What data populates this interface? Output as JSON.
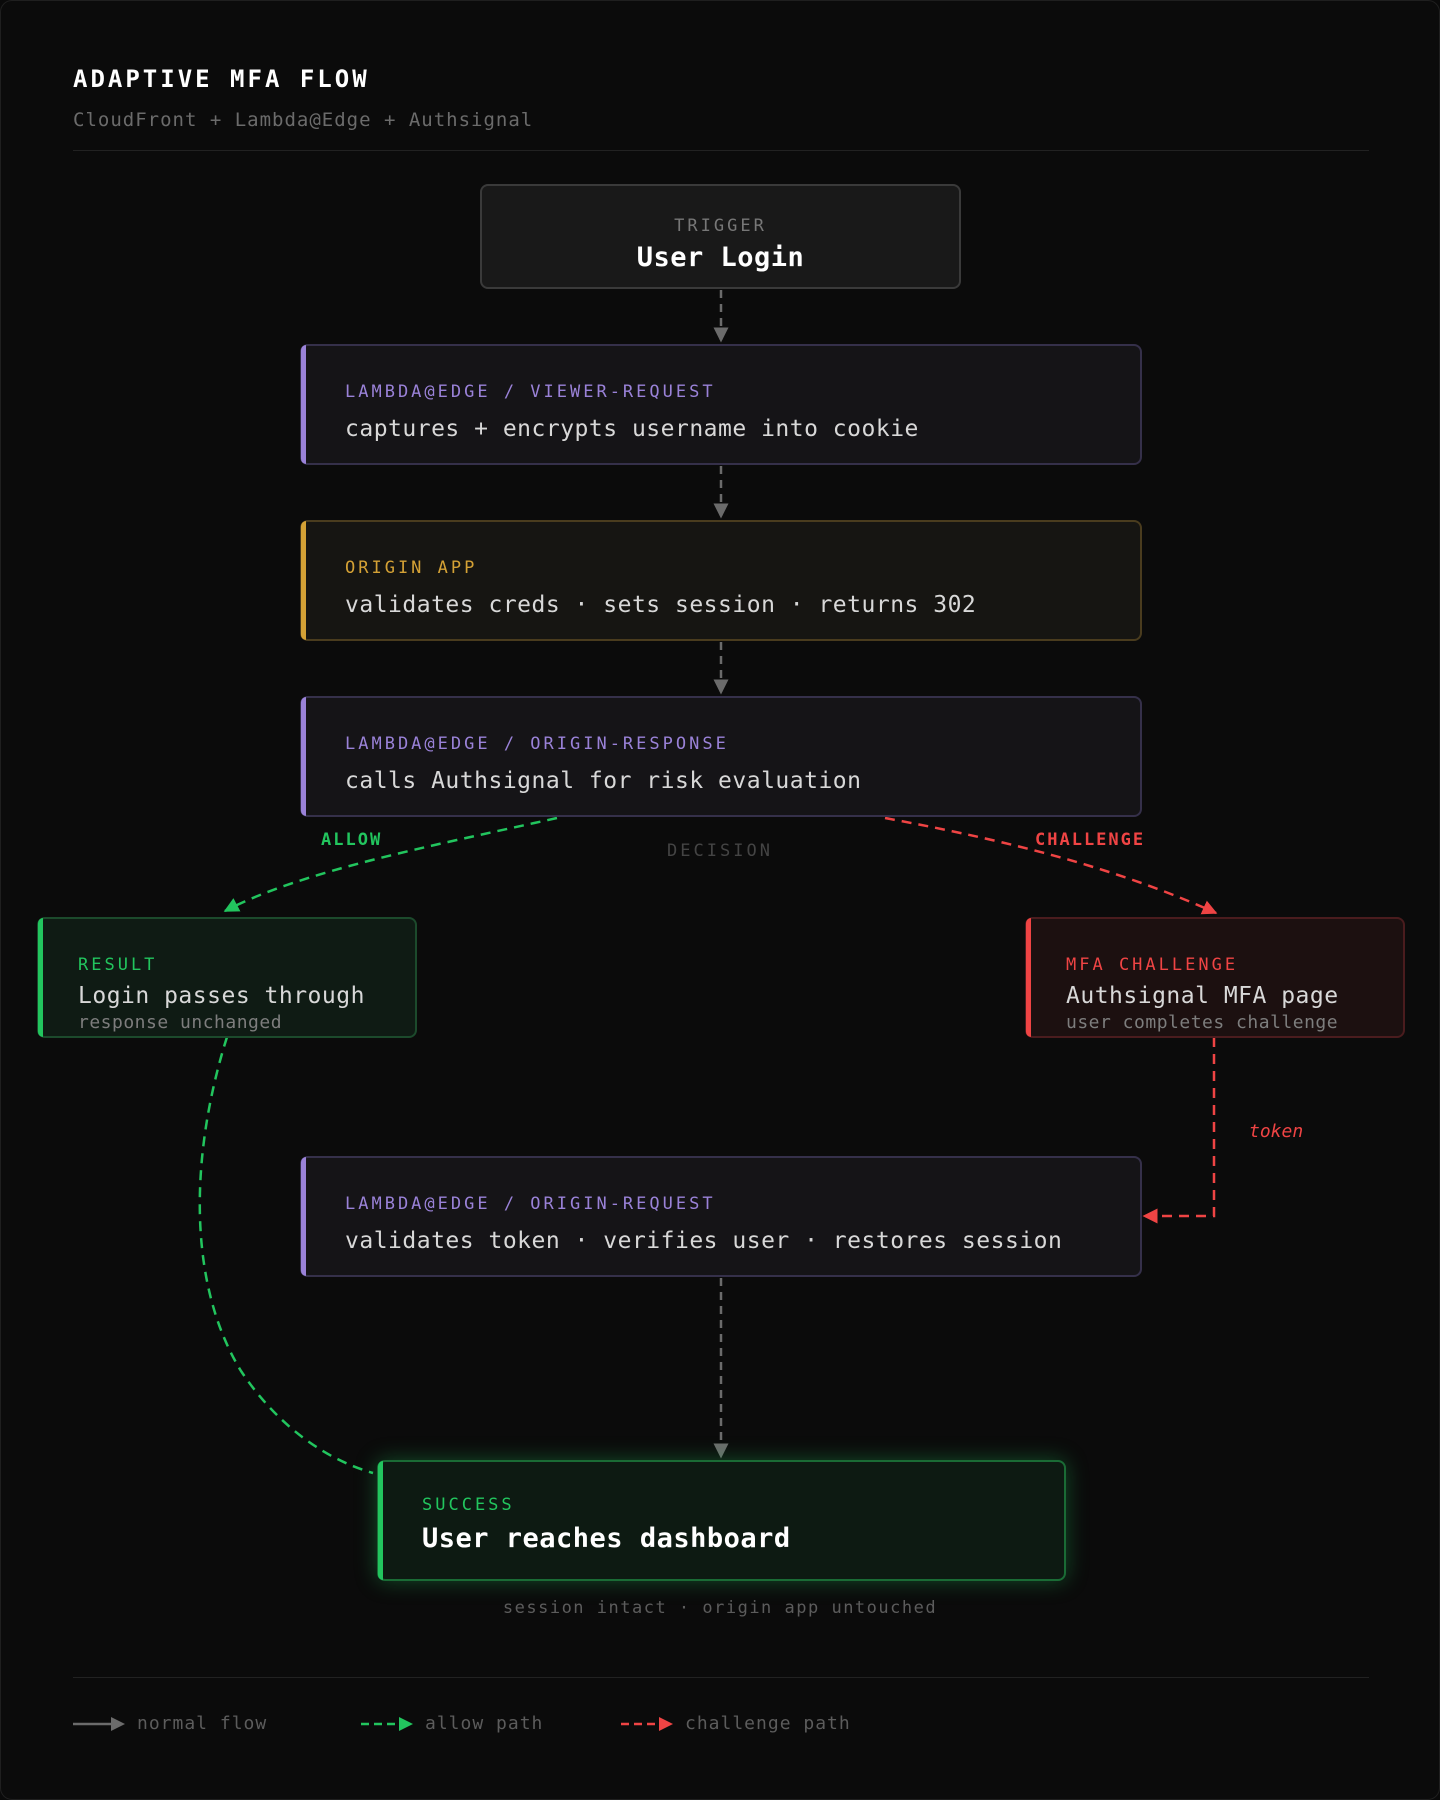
{
  "header": {
    "title": "ADAPTIVE MFA FLOW",
    "subtitle": "CloudFront + Lambda@Edge + Authsignal"
  },
  "nodes": {
    "trigger": {
      "label": "TRIGGER",
      "text": "User Login"
    },
    "viewer_request": {
      "label": "LAMBDA@EDGE / VIEWER-REQUEST",
      "text": "captures + encrypts username into cookie"
    },
    "origin_app": {
      "label": "ORIGIN APP",
      "text": "validates creds · sets session · returns 302"
    },
    "origin_response": {
      "label": "LAMBDA@EDGE / ORIGIN-RESPONSE",
      "text": "calls Authsignal for risk evaluation"
    },
    "result": {
      "label": "RESULT",
      "text": "Login passes through",
      "sub": "response unchanged"
    },
    "mfa_challenge": {
      "label": "MFA CHALLENGE",
      "text": "Authsignal MFA page",
      "sub": "user completes challenge"
    },
    "origin_request": {
      "label": "LAMBDA@EDGE / ORIGIN-REQUEST",
      "text": "validates token · verifies user · restores session"
    },
    "success": {
      "label": "SUCCESS",
      "text": "User reaches dashboard"
    }
  },
  "edges": {
    "allow_label": "ALLOW",
    "challenge_label": "CHALLENGE",
    "decision_label": "DECISION",
    "token_label": "token",
    "success_note": "session intact · origin app untouched"
  },
  "legend": [
    {
      "label": "normal flow",
      "color": "#6b6b6b",
      "style": "solid"
    },
    {
      "label": "allow path",
      "color": "#22c55e",
      "style": "dashed"
    },
    {
      "label": "challenge path",
      "color": "#ef4444",
      "style": "dashed"
    }
  ],
  "colors": {
    "background": "#0b0b0b",
    "lambda_accent": "#9a82d8",
    "origin_accent": "#d4a135",
    "allow": "#22c55e",
    "challenge": "#ef4444",
    "neutral_arrow": "#6b6b6b"
  }
}
